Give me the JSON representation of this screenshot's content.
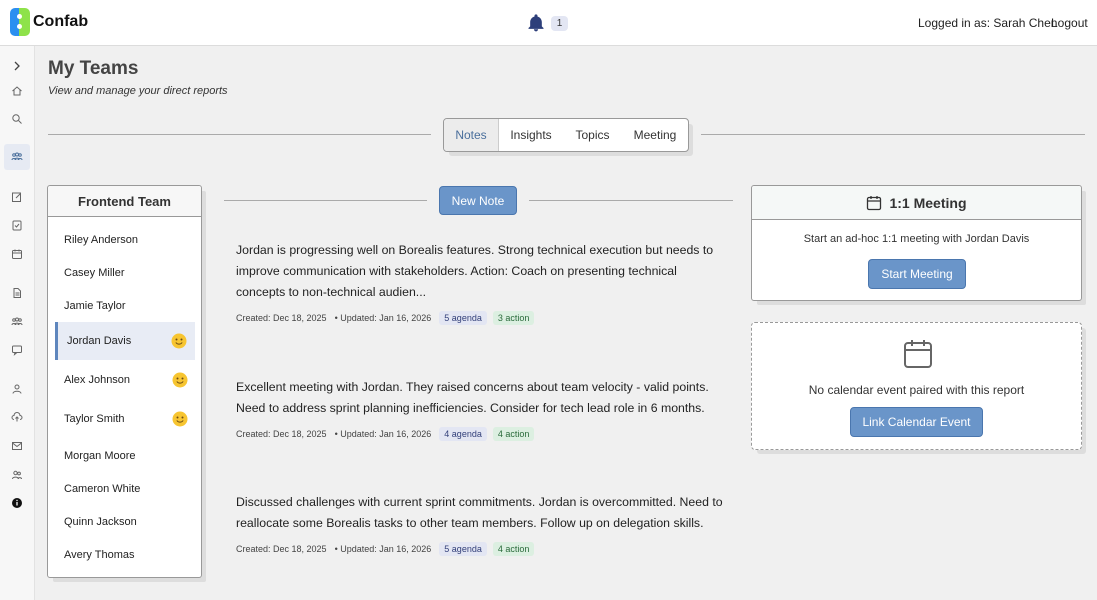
{
  "header": {
    "brand": "Confab",
    "notification_count": "1",
    "logged_in_label": "Logged in as: Sarah Chen",
    "logout_label": "Logout"
  },
  "sidebar": {
    "icons": [
      "chevron-right-icon",
      "home-icon",
      "search-icon",
      "team-icon",
      "edit-icon",
      "clipboard-icon",
      "calendar-icon",
      "document-icon",
      "group-icon",
      "chat-icon",
      "user-icon",
      "cloud-icon",
      "mail-icon",
      "users-icon",
      "info-icon"
    ],
    "active": "team-icon"
  },
  "page": {
    "title": "My Teams",
    "subtitle": "View and manage your direct reports"
  },
  "tabs": [
    {
      "label": "Notes",
      "active": true
    },
    {
      "label": "Insights",
      "active": false
    },
    {
      "label": "Topics",
      "active": false
    },
    {
      "label": "Meeting",
      "active": false
    }
  ],
  "team": {
    "title": "Frontend Team",
    "members": [
      {
        "name": "Riley Anderson",
        "emoji": false,
        "selected": false
      },
      {
        "name": "Casey Miller",
        "emoji": false,
        "selected": false
      },
      {
        "name": "Jamie Taylor",
        "emoji": false,
        "selected": false
      },
      {
        "name": "Jordan Davis",
        "emoji": true,
        "selected": true
      },
      {
        "name": "Alex Johnson",
        "emoji": true,
        "selected": false
      },
      {
        "name": "Taylor Smith",
        "emoji": true,
        "selected": false
      },
      {
        "name": "Morgan Moore",
        "emoji": false,
        "selected": false
      },
      {
        "name": "Cameron White",
        "emoji": false,
        "selected": false
      },
      {
        "name": "Quinn Jackson",
        "emoji": false,
        "selected": false
      },
      {
        "name": "Avery Thomas",
        "emoji": false,
        "selected": false
      }
    ]
  },
  "notes_section": {
    "new_note_label": "New Note",
    "notes": [
      {
        "text": "Jordan is progressing well on Borealis features. Strong technical execution but needs to improve communication with stakeholders. Action: Coach on presenting technical concepts to non-technical audien...",
        "created": "Created: Dec 18, 2025",
        "updated": "• Updated: Jan 16, 2026",
        "agenda": "5 agenda",
        "action": "3 action"
      },
      {
        "text": "Excellent meeting with Jordan. They raised concerns about team velocity - valid points. Need to address sprint planning inefficiencies. Consider for tech lead role in 6 months.",
        "created": "Created: Dec 18, 2025",
        "updated": "• Updated: Jan 16, 2026",
        "agenda": "4 agenda",
        "action": "4 action"
      },
      {
        "text": "Discussed challenges with current sprint commitments. Jordan is overcommitted. Need to reallocate some Borealis tasks to other team members. Follow up on delegation skills.",
        "created": "Created: Dec 18, 2025",
        "updated": "• Updated: Jan 16, 2026",
        "agenda": "5 agenda",
        "action": "4 action"
      }
    ]
  },
  "meeting_card": {
    "title": "1:1 Meeting",
    "description": "Start an ad-hoc 1:1 meeting with Jordan Davis",
    "button_label": "Start Meeting"
  },
  "calendar_card": {
    "message": "No calendar event paired with this report",
    "button_label": "Link Calendar Event"
  },
  "colors": {
    "accent": "#6a95c9",
    "agenda_badge": "#e3e6f3",
    "action_badge": "#dcefe1"
  }
}
